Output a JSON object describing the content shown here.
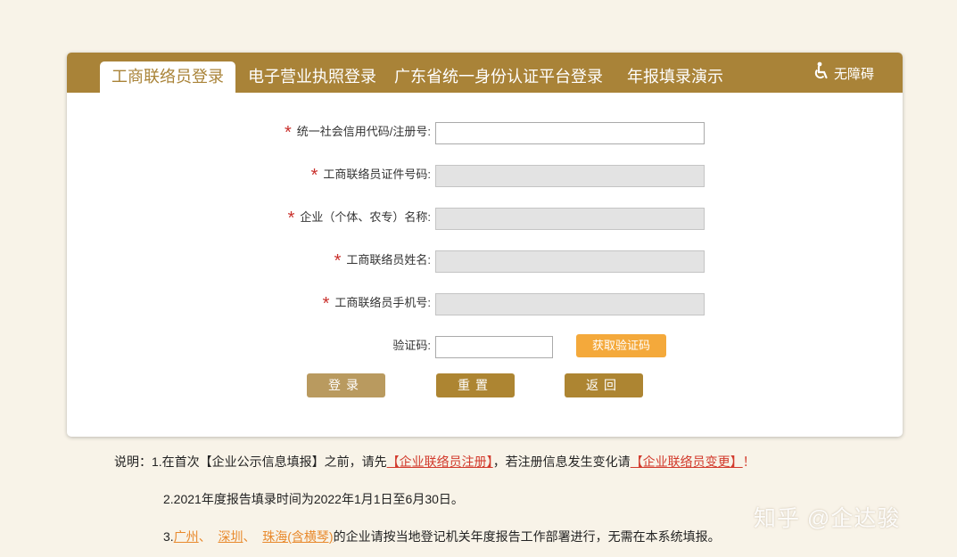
{
  "tabs": [
    {
      "label": "工商联络员登录",
      "active": true
    },
    {
      "label": "电子营业执照登录"
    },
    {
      "label": "广东省统一身份认证平台登录"
    },
    {
      "label": "年报填录演示"
    }
  ],
  "accessibility": {
    "label": "无障碍",
    "icon": "wheelchair-icon"
  },
  "form": {
    "credit_code_label": "统一社会信用代码/注册号:",
    "id_number_label": "工商联络员证件号码:",
    "company_name_label": "企业（个体、农专）名称:",
    "contact_name_label": "工商联络员姓名:",
    "phone_label": "工商联络员手机号:",
    "captcha_label": "验证码:",
    "required_mark": "*",
    "credit_code_value": "",
    "id_number_value": "",
    "company_name_value": "",
    "contact_name_value": "",
    "phone_value": "",
    "captcha_value": "",
    "get_code_button": "获取验证码"
  },
  "buttons": {
    "login": "登录",
    "reset": "重置",
    "back": "返回"
  },
  "notes": {
    "line1_prefix": "说明：1.在首次【企业公示信息填报】之前，请先",
    "line1_link1": "【企业联络员注册】",
    "line1_middle": "，若注册信息发生变化请",
    "line1_link2": "【企业联络员变更】",
    "line1_suffix": "！",
    "line2": "2.2021年度报告填录时间为2022年1月1日至6月30日。",
    "line3_prefix": "3.",
    "city1": "广州",
    "sep1": "、",
    "city2": "深圳",
    "sep2": "、",
    "city3": "珠海(含横琴)",
    "line3_suffix": "的企业请按当地登记机关年度报告工作部署进行，无需在本系统填报。"
  },
  "watermark": "知乎 @企达骏",
  "colors": {
    "tab_bar": "#a98338",
    "page_bg": "#f8f3e8",
    "required_star": "#c9302c",
    "get_code_button": "#f4a93b",
    "login_button": "#b99a5f",
    "action_button": "#ad8532",
    "link_red": "#d23a2c",
    "link_orange": "#e8892c"
  }
}
